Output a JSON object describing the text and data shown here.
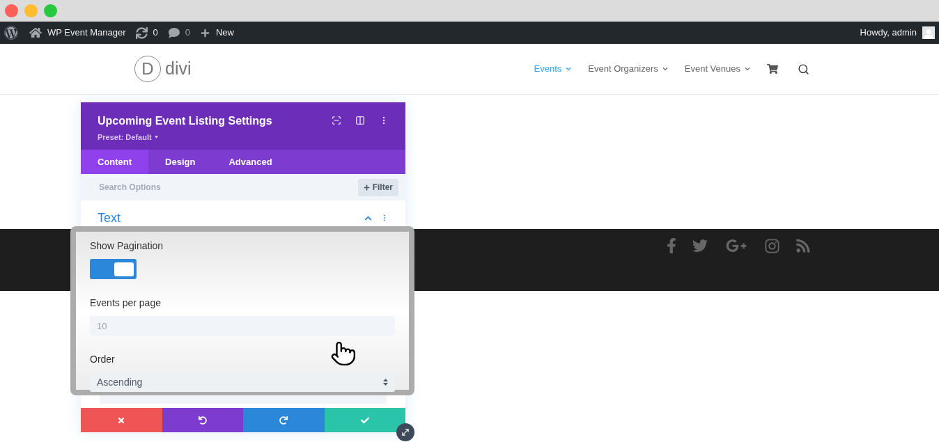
{
  "admin_bar": {
    "site_name": "WP Event Manager",
    "updates_count": "0",
    "comments_count": "0",
    "new_label": "New",
    "greeting": "Howdy, admin"
  },
  "header": {
    "logo_letter": "D",
    "logo_text": "divi",
    "nav": [
      {
        "label": "Events",
        "selected": true
      },
      {
        "label": "Event Organizers",
        "selected": false
      },
      {
        "label": "Event Venues",
        "selected": false
      }
    ]
  },
  "settings_panel": {
    "title": "Upcoming Event Listing Settings",
    "preset": "Preset: Default",
    "tabs": [
      {
        "label": "Content",
        "selected": true
      },
      {
        "label": "Design",
        "selected": false
      },
      {
        "label": "Advanced",
        "selected": false
      }
    ],
    "search": {
      "placeholder": "Search Options"
    },
    "filter_button": "Filter",
    "section": {
      "title": "Text",
      "expanded": true
    }
  },
  "magnified_fields": [
    {
      "kind": "toggle",
      "label": "Show Pagination",
      "on": true
    },
    {
      "kind": "number",
      "label": "Events per page",
      "placeholder": "10"
    },
    {
      "kind": "select",
      "label": "Order",
      "value": "Ascending"
    }
  ]
}
